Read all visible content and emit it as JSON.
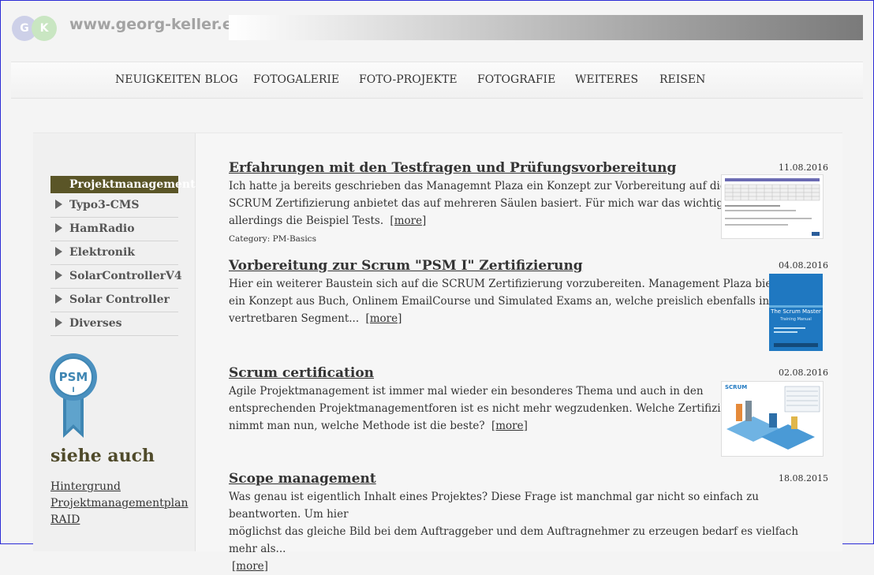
{
  "header": {
    "logo_g": "G",
    "logo_k": "K",
    "site_url": "www.georg-keller.eu"
  },
  "nav": {
    "items": [
      {
        "label": "NEUIGKEITEN BLOG"
      },
      {
        "label": "FOTOGALERIE"
      },
      {
        "label": "FOTO-PROJEKTE"
      },
      {
        "label": "FOTOGRAFIE"
      },
      {
        "label": "WEITERES"
      },
      {
        "label": "REISEN"
      }
    ]
  },
  "sidebar": {
    "menu": [
      {
        "label": "Projektmanagement",
        "active": true
      },
      {
        "label": "Typo3-CMS"
      },
      {
        "label": "HamRadio"
      },
      {
        "label": "Elektronik"
      },
      {
        "label": "SolarControllerV4"
      },
      {
        "label": "Solar Controller"
      },
      {
        "label": "Diverses"
      }
    ],
    "badge_text": "PSM",
    "badge_sub": "I",
    "see_also_heading": "siehe auch",
    "links": [
      {
        "label": "Hintergrund"
      },
      {
        "label": "Projektmanagementplan"
      },
      {
        "label": "RAID"
      }
    ]
  },
  "articles": [
    {
      "title": "Erfahrungen mit den Testfragen und Prüfungsvorbereitung",
      "date": "11.08.2016",
      "lines": [
        "Ich hatte ja bereits geschrieben das Managemnt Plaza ein Konzept zur Vorbereitung auf die",
        "SCRUM Zertifizierung anbietet das auf mehreren Säulen basiert. Für mich war das wichtigste",
        "allerdings die Beispiel Tests."
      ],
      "more": "[more]",
      "category": "Category: PM-Basics"
    },
    {
      "title": "Vorbereitung zur Scrum \"PSM I\" Zertifizierung",
      "date": "04.08.2016",
      "lines": [
        "Hier ein weiterer Baustein sich auf die SCRUM Zertifizierung vorzubereiten. Management Plaza bietet dazu",
        "ein Konzept aus Buch, Onlinem EmailCourse und Simulated Exams an, welche preislich ebenfalls in einem",
        "vertretbaren Segment..."
      ],
      "more": "[more]",
      "thumb_title": "The Scrum Master",
      "thumb_sub": "Training Manual"
    },
    {
      "title": "Scrum certification",
      "date": "02.08.2016",
      "lines": [
        "Agile Projektmanagement ist immer mal wieder ein besonderes Thema und auch in den",
        "entsprechenden Projektmanagementforen ist es nicht mehr wegzudenken. Welche Zertifizierung",
        "nimmt man nun, welche Methode ist die beste?"
      ],
      "more": "[more]",
      "thumb_label": "SCRUM"
    },
    {
      "title": "Scope management",
      "date": "18.08.2015",
      "lines": [
        "Was genau ist eigentlich Inhalt eines Projektes? Diese Frage ist manchmal gar nicht so einfach zu beantworten. Um hier",
        "möglichst das gleiche Bild bei dem Auftraggeber und dem Auftragnehmer zu erzeugen bedarf es vielfach mehr als..."
      ],
      "more": "[more]"
    }
  ]
}
